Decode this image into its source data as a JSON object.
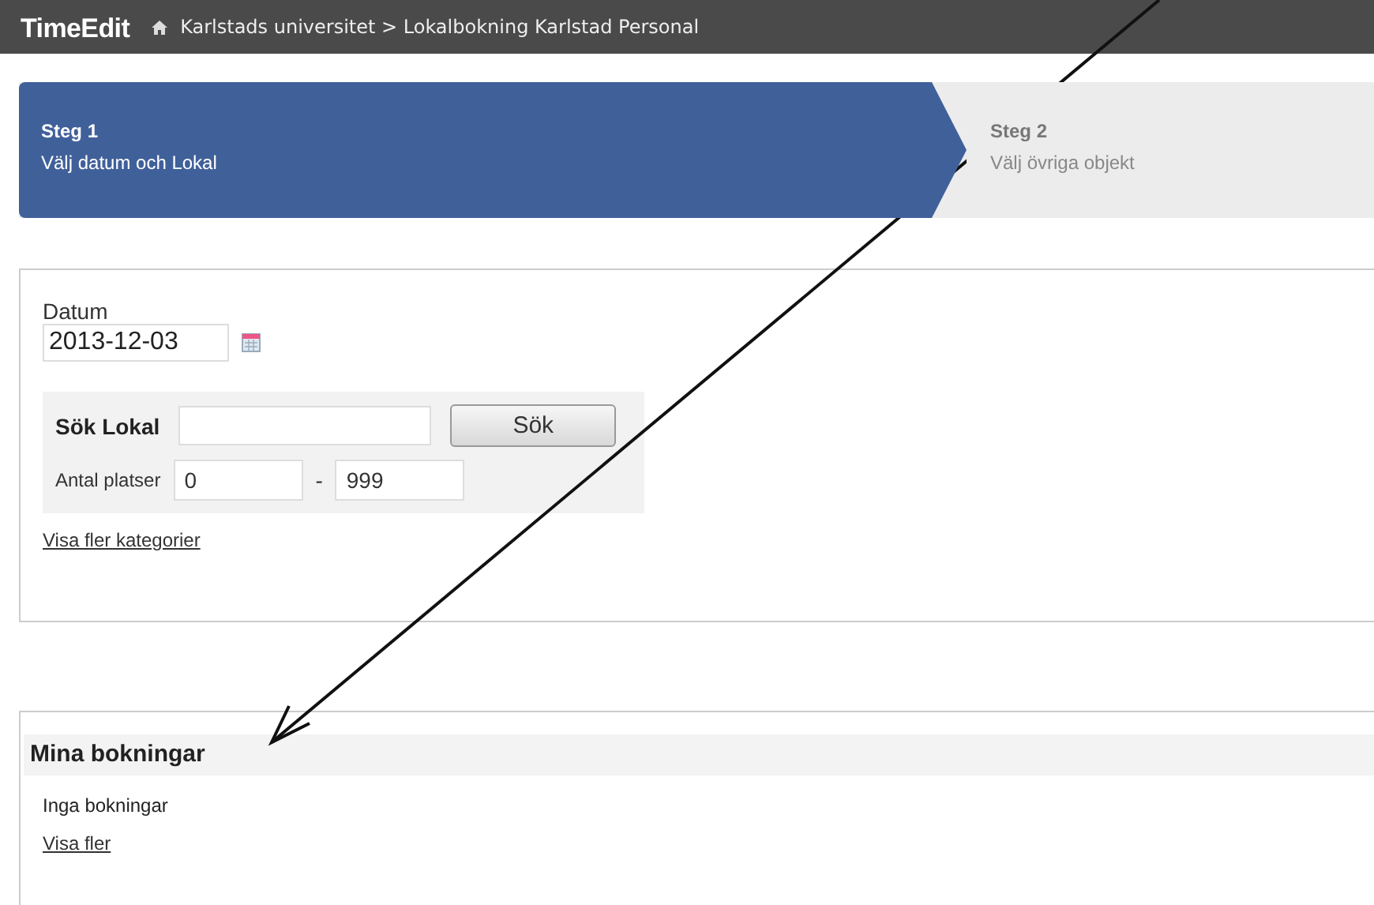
{
  "header": {
    "logo": "TimeEdit",
    "breadcrumb": "Karlstads universitet > Lokalbokning Karlstad Personal"
  },
  "steps": [
    {
      "title": "Steg 1",
      "subtitle": "Välj datum och Lokal",
      "selected": true
    },
    {
      "title": "Steg 2",
      "subtitle": "Välj övriga objekt",
      "selected": false
    }
  ],
  "form": {
    "date_label": "Datum",
    "date_value": "2013-12-03",
    "search_label": "Sök Lokal",
    "search_button": "Sök",
    "seats_label": "Antal platser",
    "seats_min": "0",
    "seats_separator": "-",
    "seats_max": "999",
    "more_link": "Visa fler kategorier"
  },
  "bookings": {
    "title": "Mina bokningar",
    "empty_text": "Inga bokningar",
    "more_link": "Visa fler"
  }
}
